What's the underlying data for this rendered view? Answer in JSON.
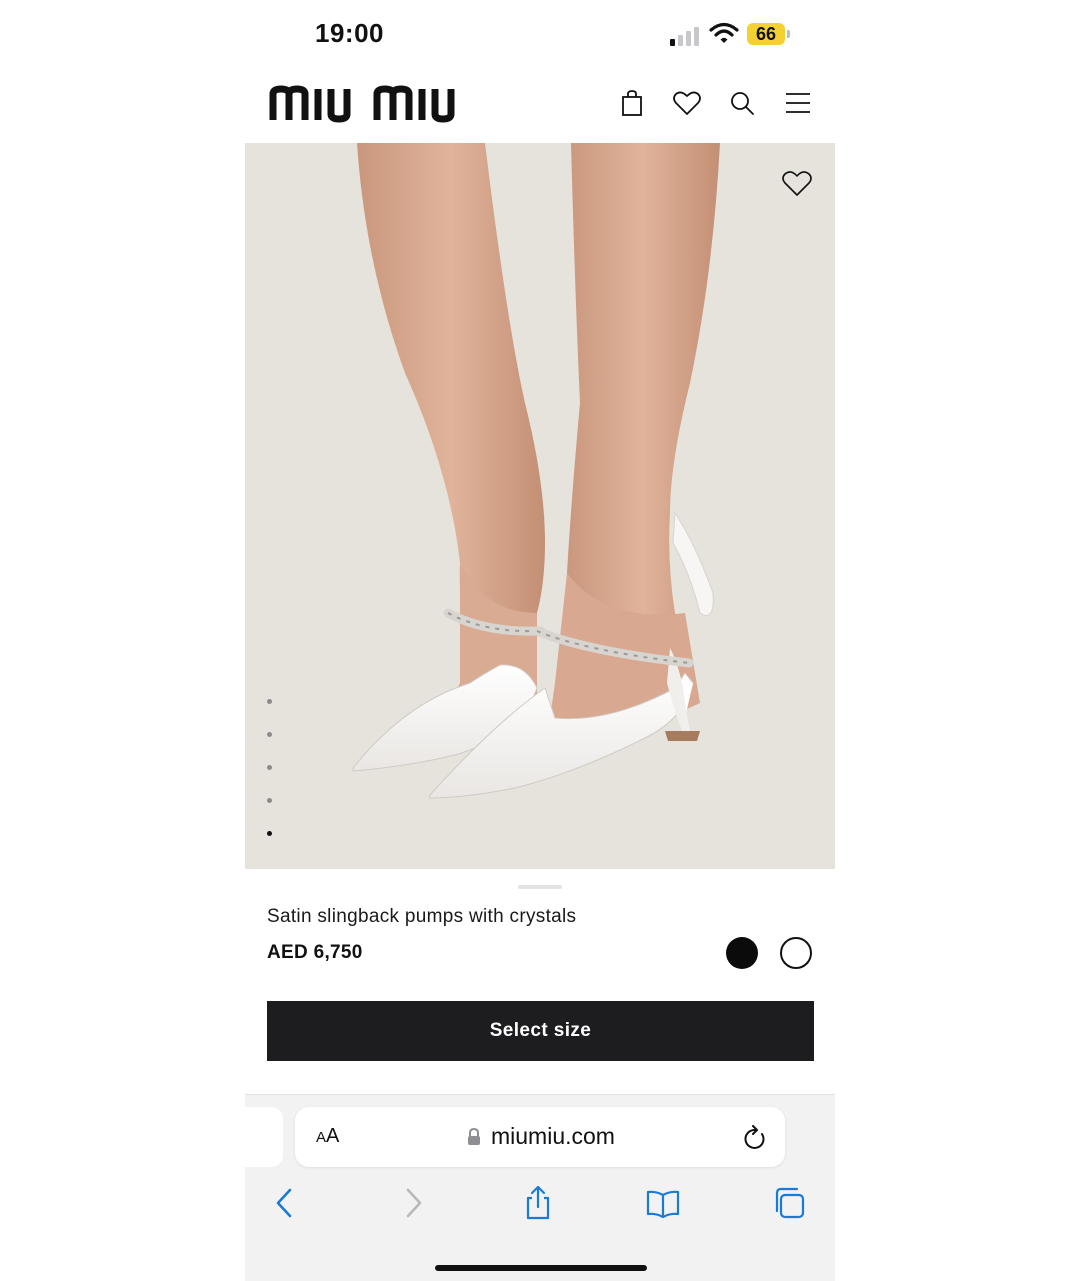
{
  "status_bar": {
    "time": "19:00",
    "battery": "66"
  },
  "header": {
    "brand": "miu miu"
  },
  "hero": {
    "carousel_total": 5,
    "carousel_active_index": 4
  },
  "product": {
    "name": "Satin slingback pumps with crystals",
    "price": "AED 6,750",
    "colors": [
      "#0b0b0b",
      "#ffffff"
    ],
    "cta_label": "Select size"
  },
  "browser": {
    "text_size_label_big": "A",
    "text_size_label_small": "A",
    "domain": "miumiu.com"
  },
  "colors": {
    "hero_bg": "#e6e2dc",
    "cta_bg": "#1d1d1f",
    "safari_blue": "#1a7bd6",
    "battery": "#f4d130"
  }
}
